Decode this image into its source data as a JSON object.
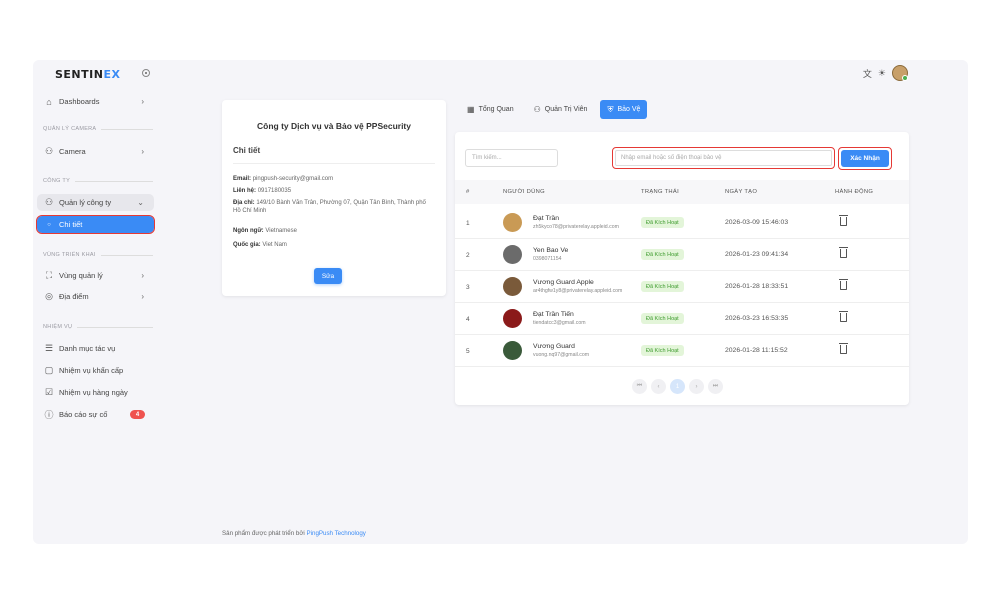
{
  "brand": {
    "part1": "SENTIN",
    "part2": "EX"
  },
  "sidebar": {
    "dashboards": "Dashboards",
    "section_camera": "QUẢN LÝ CAMERA",
    "camera": "Camera",
    "section_company": "CÔNG TY",
    "company_manage": "Quản lý công ty",
    "detail": "Chi tiết",
    "section_area": "VÙNG TRIỂN KHAI",
    "area_manage": "Vùng quản lý",
    "location": "Địa điểm",
    "section_task": "NHIỆM VỤ",
    "task_catalog": "Danh mục tác vụ",
    "urgent_task": "Nhiệm vụ khẩn cấp",
    "daily_task": "Nhiệm vụ hàng ngày",
    "incident_report": "Báo cáo sự cố",
    "incident_count": "4"
  },
  "company": {
    "title": "Công ty Dịch vụ và Bảo vệ PPSecurity",
    "subtitle": "Chi tiết",
    "email_label": "Email:",
    "email": "pingpush-security@gmail.com",
    "phone_label": "Liên hệ:",
    "phone": "0917180035",
    "address_label": "Địa chỉ:",
    "address": "149/10 Bành Văn Trân, Phường 07, Quận Tân Bình, Thành phố Hồ Chí Minh",
    "language_label": "Ngôn ngữ:",
    "language": "Vietnamese",
    "country_label": "Quốc gia:",
    "country": "Viet Nam",
    "edit_label": "Sửa"
  },
  "tabs": [
    {
      "label": "Tổng Quan",
      "icon": "grid-icon"
    },
    {
      "label": "Quản Trị Viên",
      "icon": "users-icon"
    },
    {
      "label": "Bảo Vệ",
      "icon": "shield-icon",
      "active": true
    }
  ],
  "table": {
    "search_placeholder": "Tìm kiếm...",
    "phone_placeholder": "Nhập email hoặc số điện thoại bảo vệ",
    "confirm_label": "Xác Nhận",
    "headers": [
      "#",
      "NGƯỜI DÙNG",
      "TRẠNG THÁI",
      "NGÀY TẠO",
      "HÀNH ĐỘNG"
    ],
    "rows": [
      {
        "idx": "1",
        "name": "Đạt Trần",
        "email": "zh5kyco78@privaterelay.appleid.com",
        "status": "Đã Kích Hoạt",
        "date": "2026-03-09 15:46:03",
        "avatar_color": "#c99a55"
      },
      {
        "idx": "2",
        "name": "Yen Bao Ve",
        "email": "0398071154",
        "status": "Đã Kích Hoạt",
        "date": "2026-01-23 09:41:34",
        "avatar_color": "#6b6b6b"
      },
      {
        "idx": "3",
        "name": "Vương Guard Apple",
        "email": "ar4thgfw1y8@privaterelay.appleid.com",
        "status": "Đã Kích Hoạt",
        "date": "2026-01-28 18:33:51",
        "avatar_color": "#7a5a3a"
      },
      {
        "idx": "4",
        "name": "Đạt Trần Tiến",
        "email": "tiendatcc3@gmail.com",
        "status": "Đã Kích Hoạt",
        "date": "2026-03-23 16:53:35",
        "avatar_color": "#8b1a1a"
      },
      {
        "idx": "5",
        "name": "Vương Guard",
        "email": "vuong.nq97@gmail.com",
        "status": "Đã Kích Hoạt",
        "date": "2026-01-28 11:15:52",
        "avatar_color": "#3a5a3a"
      }
    ]
  },
  "pager": {
    "first": "⏮",
    "prev": "‹",
    "current": "1",
    "next": "›",
    "last": "⏭"
  },
  "footer": {
    "text": "Sản phẩm được phát triển bởi ",
    "link": "PingPush Technology"
  },
  "colors": {
    "accent": "#3a8bf5",
    "highlight": "#e53935",
    "status_bg": "#e3f5d9"
  }
}
